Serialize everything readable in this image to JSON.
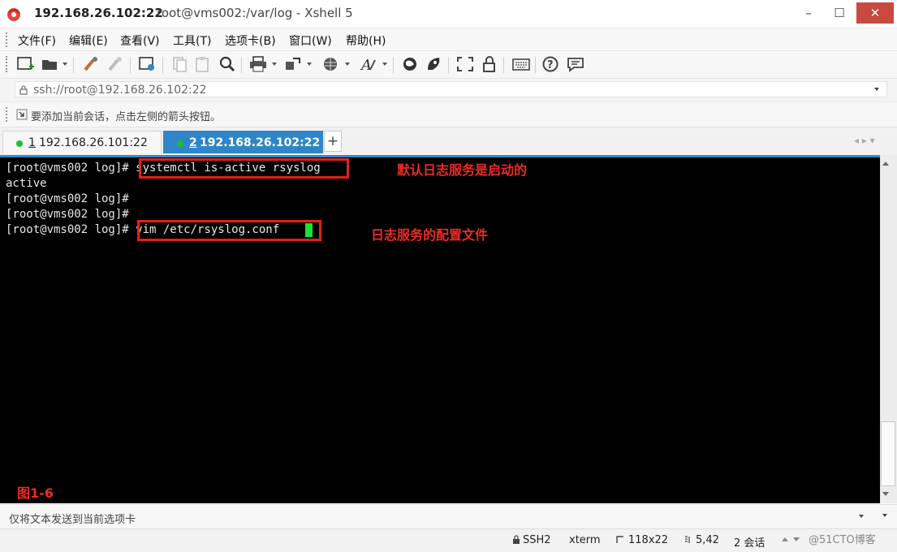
{
  "window": {
    "title_host": "192.168.26.102:22",
    "title_rest": "root@vms002:/var/log - Xshell 5",
    "minimize_glyph": "–",
    "maximize_glyph": "☐",
    "close_glyph": "✕"
  },
  "menu": [
    "文件(F)",
    "编辑(E)",
    "查看(V)",
    "工具(T)",
    "选项卡(B)",
    "窗口(W)",
    "帮助(H)"
  ],
  "toolbar": {
    "icons": [
      "new-session-icon",
      "open-folder-icon",
      "reconnect-icon",
      "disconnect-icon",
      "properties-icon",
      "copy-icon",
      "paste-icon",
      "find-icon",
      "print-icon",
      "transfer-icon",
      "globe-icon",
      "font-icon",
      "xftp-icon",
      "xagent-icon",
      "fullscreen-icon",
      "lock-icon",
      "keyboard-icon",
      "help-icon",
      "chat-icon"
    ]
  },
  "address": {
    "value": "ssh://root@192.168.26.102:22"
  },
  "hint": {
    "text": "要添加当前会话，点击左侧的箭头按钮。"
  },
  "tabs": [
    {
      "num": "1",
      "label": "192.168.26.101:22",
      "active": false
    },
    {
      "num": "2",
      "label": "192.168.26.102:22",
      "active": true
    }
  ],
  "tab_add": "+",
  "tab_nav": "◂ ▸ ▾",
  "terminal": {
    "lines": [
      {
        "prompt": "[root@vms002 log]#",
        "cmd": " systemctl is-active rsyslog"
      },
      {
        "prompt": "active",
        "cmd": ""
      },
      {
        "prompt": "[root@vms002 log]#",
        "cmd": ""
      },
      {
        "prompt": "[root@vms002 log]#",
        "cmd": ""
      },
      {
        "prompt": "[root@vms002 log]#",
        "cmd": " vim /etc/rsyslog.conf "
      }
    ],
    "annotations": [
      "默认日志服务是启动的",
      "日志服务的配置文件"
    ],
    "figure_label": "图1-6"
  },
  "compose": {
    "text": "仅将文本发送到当前选项卡"
  },
  "status": {
    "protocol": "SSH2",
    "terminal_type": "xterm",
    "size": "118x22",
    "cursor_pos": "5,42",
    "sessions": "2 会话"
  },
  "watermark": "@51CTO博客",
  "colors": {
    "accent": "#2e86c8",
    "annotation_red": "#e32119",
    "cursor_green": "#16e332",
    "status_dot": "#1fbe2e"
  }
}
